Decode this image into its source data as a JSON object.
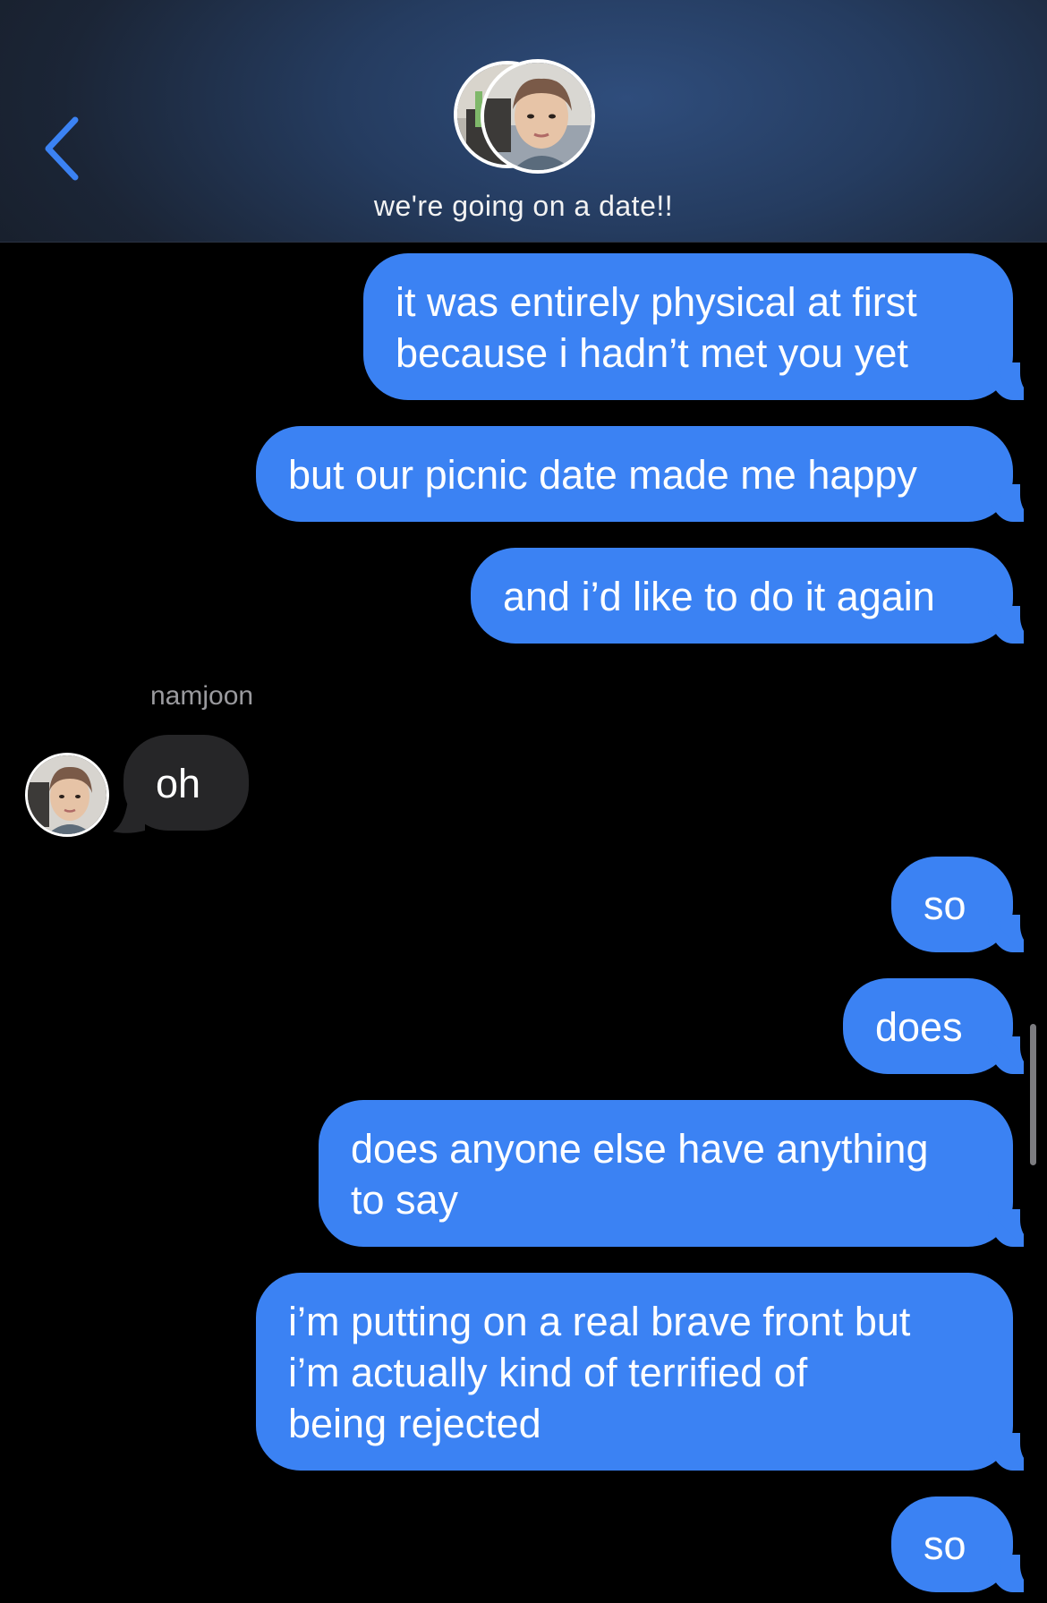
{
  "header": {
    "back_icon": "chevron-left-icon",
    "title": "we're going on a date!!",
    "accent_color": "#3b82f3"
  },
  "messages": [
    {
      "direction": "out",
      "lines": [
        "it was entirely physical at first",
        "because i hadn’t met you yet"
      ]
    },
    {
      "direction": "out",
      "lines": [
        "but our picnic date made me happy"
      ]
    },
    {
      "direction": "out",
      "lines": [
        "and i’d like to do it again"
      ]
    },
    {
      "direction": "in",
      "sender": "namjoon",
      "lines": [
        "oh"
      ]
    },
    {
      "direction": "out",
      "lines": [
        "so"
      ]
    },
    {
      "direction": "out",
      "lines": [
        "does"
      ]
    },
    {
      "direction": "out",
      "lines": [
        "does anyone else have anything",
        "to say"
      ]
    },
    {
      "direction": "out",
      "lines": [
        "i’m putting on a real brave front but",
        "i’m actually kind of terrified of",
        "being rejected"
      ]
    },
    {
      "direction": "out",
      "lines": [
        "so"
      ]
    }
  ],
  "colors": {
    "outgoing_bubble": "#3b82f3",
    "incoming_bubble": "#262628",
    "background": "#000000"
  }
}
